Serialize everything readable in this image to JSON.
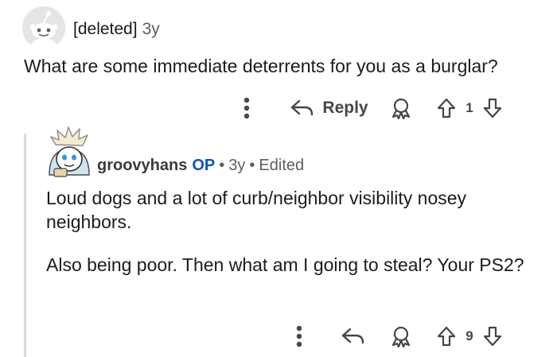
{
  "parent_comment": {
    "author": "[deleted]",
    "age": "3y",
    "body": "What are some immediate deterrents for you as a burglar?",
    "actions": {
      "more_icon": "vertical-ellipsis-icon",
      "reply_label": "Reply",
      "award_icon": "award-icon",
      "vote_count": "1"
    }
  },
  "reply_comment": {
    "author": "groovyhans",
    "op_badge": "OP",
    "age": "3y",
    "edited_label": "Edited",
    "separator": "•",
    "paragraphs": [
      "Loud dogs and a lot of curb/neighbor visibility nosey neighbors.",
      "Also being poor. Then what am I going to steal? Your PS2?"
    ],
    "actions": {
      "vote_count": "9"
    }
  },
  "colors": {
    "text": "#1c1c1c",
    "meta": "#5c5e60",
    "op_badge": "#0a55b3",
    "icon": "#444648",
    "thread_line": "#d9dadc"
  }
}
